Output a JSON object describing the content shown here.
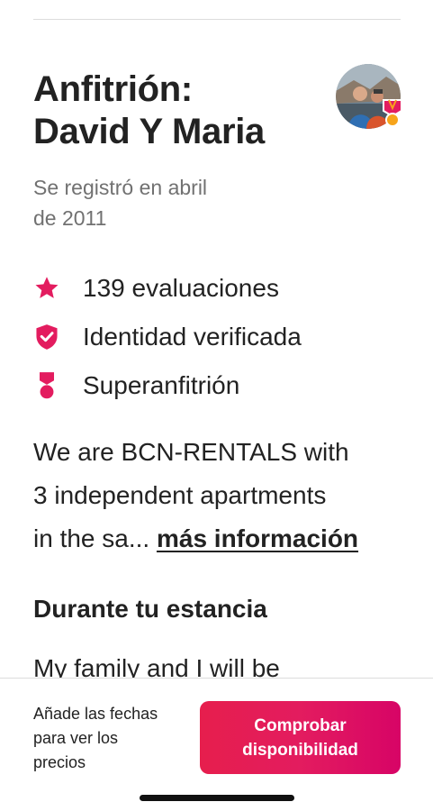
{
  "host": {
    "title_line1": "Anfitrión:",
    "title_line2": "David Y Maria",
    "registered_line1": "Se registró en abril",
    "registered_line2": "de 2011",
    "avatar_badge": "superhost-badge-icon"
  },
  "stats": [
    {
      "icon": "star-icon",
      "label": "139 evaluaciones"
    },
    {
      "icon": "shield-check-icon",
      "label": "Identidad verificada"
    },
    {
      "icon": "superhost-medal-icon",
      "label": "Superanfitrión"
    }
  ],
  "about": {
    "line1": "We are BCN-RENTALS with",
    "line2": "3 independent apartments",
    "line3_prefix": "in the sa... ",
    "more_link": "más información"
  },
  "stay": {
    "title": "Durante tu estancia",
    "text": "My family and I will be"
  },
  "footer": {
    "hint_line1": "Añade las fechas",
    "hint_line2": "para ver los",
    "hint_line3": "precios",
    "cta_line1": "Comprobar",
    "cta_line2": "disponibilidad"
  },
  "colors": {
    "accent": "#E31C5F",
    "text": "#222222",
    "muted": "#717171",
    "divider": "#DDDDDD"
  }
}
